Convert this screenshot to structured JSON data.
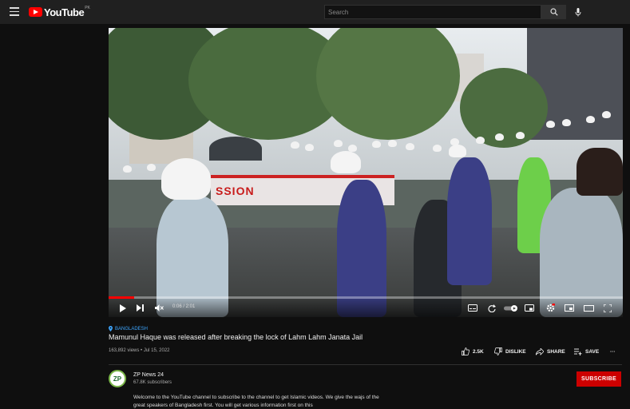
{
  "app": {
    "logo_text": "YouTube",
    "region": "PK"
  },
  "search": {
    "placeholder": "Search"
  },
  "player": {
    "time": "0:06 / 2:01",
    "progress_fraction": 0.05,
    "banner_text": "SSION"
  },
  "video": {
    "location": "BANGLADESH",
    "title": "Mamunul Haque was released after breaking the lock of Lahm Lahm Janata Jail",
    "views": "163,892 views",
    "date": "Jul 15, 2022",
    "likes": "2.5K",
    "dislike_label": "DISLIKE",
    "share_label": "SHARE",
    "save_label": "SAVE",
    "more_label": "···"
  },
  "channel": {
    "avatar_text": "ZP",
    "name": "ZP News 24",
    "subscribers": "67.8K subscribers",
    "subscribe_label": "SUBSCRIBE"
  },
  "description": "Welcome to the YouTube channel to subscribe to the channel to get Islamic videos. We give the wajs of the great speakers of Bangladesh first. You will get various information first on this",
  "icons": [
    "menu-icon",
    "youtube-logo-icon",
    "search-icon",
    "mic-icon",
    "play-icon",
    "next-icon",
    "mute-icon",
    "subtitles-icon",
    "autoplay-icon",
    "miniplayer-icon",
    "settings-icon",
    "theater-icon",
    "fullscreen-icon",
    "location-pin-icon",
    "like-icon",
    "dislike-icon",
    "share-icon",
    "save-icon"
  ],
  "colors": {
    "accent": "#ff0000",
    "subscribe": "#cc0000",
    "link": "#3ea6ff",
    "background": "#0f0f0f"
  }
}
